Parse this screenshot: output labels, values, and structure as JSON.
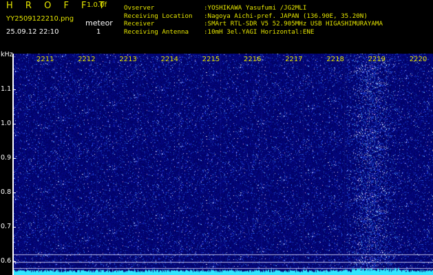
{
  "header": {
    "app_title": "H R O F F T",
    "app_version": "1.0.0f",
    "filename": "YY2509122210.png",
    "datetime": "25.09.12 22:10",
    "count_label": "meteor",
    "count_value": "1"
  },
  "info": {
    "observer_key": "Ovserver",
    "observer_val": ":YOSHIKAWA Yasufumi /JG2MLI",
    "location_key": "Receiving Location",
    "location_val": ":Nagoya Aichi-pref. JAPAN (136.90E, 35.20N)",
    "receiver_key": "Receiver",
    "receiver_val": ":SMArt RTL-SDR V5 52.905MHz USB HIGASHIMURAYAMA",
    "antenna_key": "Receiving Antenna",
    "antenna_val": ":10mH 3el.YAGI Horizontal:ENE"
  },
  "axis": {
    "unit": "kHz",
    "y_ticks": [
      {
        "label": "1.1",
        "value": 1.1
      },
      {
        "label": "1.0",
        "value": 1.0
      },
      {
        "label": "0.9",
        "value": 0.9
      },
      {
        "label": "0.8",
        "value": 0.8
      },
      {
        "label": "0.7",
        "value": 0.7
      },
      {
        "label": "0.6",
        "value": 0.6
      }
    ],
    "x_ticks": [
      "2211",
      "2212",
      "2213",
      "2214",
      "2215",
      "2216",
      "2217",
      "2218",
      "2219",
      "2220"
    ]
  },
  "colors": {
    "background": "#0a0a6e",
    "label_yellow": "#e6e600",
    "trace_cyan": "#33e6ff"
  }
}
